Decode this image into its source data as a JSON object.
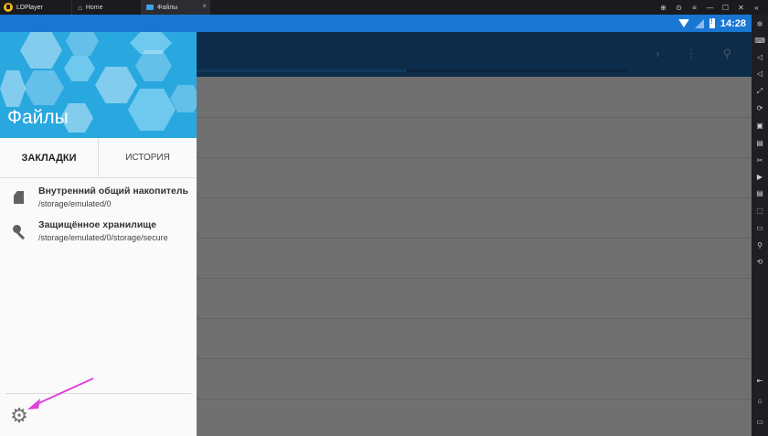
{
  "window": {
    "app_name": "LDPlayer",
    "tabs": [
      {
        "label": "Home"
      },
      {
        "label": "Файлы"
      }
    ],
    "close_glyph": "×",
    "controls": [
      "⊕",
      "⊙",
      "≡",
      "—",
      "☐",
      "✕",
      "«"
    ]
  },
  "status_bar": {
    "time": "14:28"
  },
  "toolbar": {
    "chevron": "›",
    "menu": "⋮",
    "search": "⚲"
  },
  "drawer": {
    "title": "Файлы",
    "tabs": [
      {
        "label": "ЗАКЛАДКИ",
        "active": true
      },
      {
        "label": "ИСТОРИЯ",
        "active": false
      }
    ],
    "bookmarks": [
      {
        "title": "Внутренний общий накопитель",
        "path": "/storage/emulated/0",
        "icon": "sd-card-icon"
      },
      {
        "title": "Защищённое хранилище",
        "path": "/storage/emulated/0/storage/secure",
        "icon": "key-icon"
      }
    ],
    "settings_glyph": "⚙"
  },
  "side_tools": [
    "✲",
    "⌨",
    "◁",
    "◁",
    "⤢",
    "⟳",
    "▣",
    "▤",
    "✂",
    "▶",
    "▤",
    "⬚",
    "▭",
    "⚲",
    "⟲",
    "⇤",
    "⌂",
    "▭"
  ],
  "colors": {
    "status_bar": "#1976d2",
    "app_toolbar": "#1c65a8",
    "drawer_header": "#29a8e0",
    "annotation_arrow": "#e040e0"
  }
}
